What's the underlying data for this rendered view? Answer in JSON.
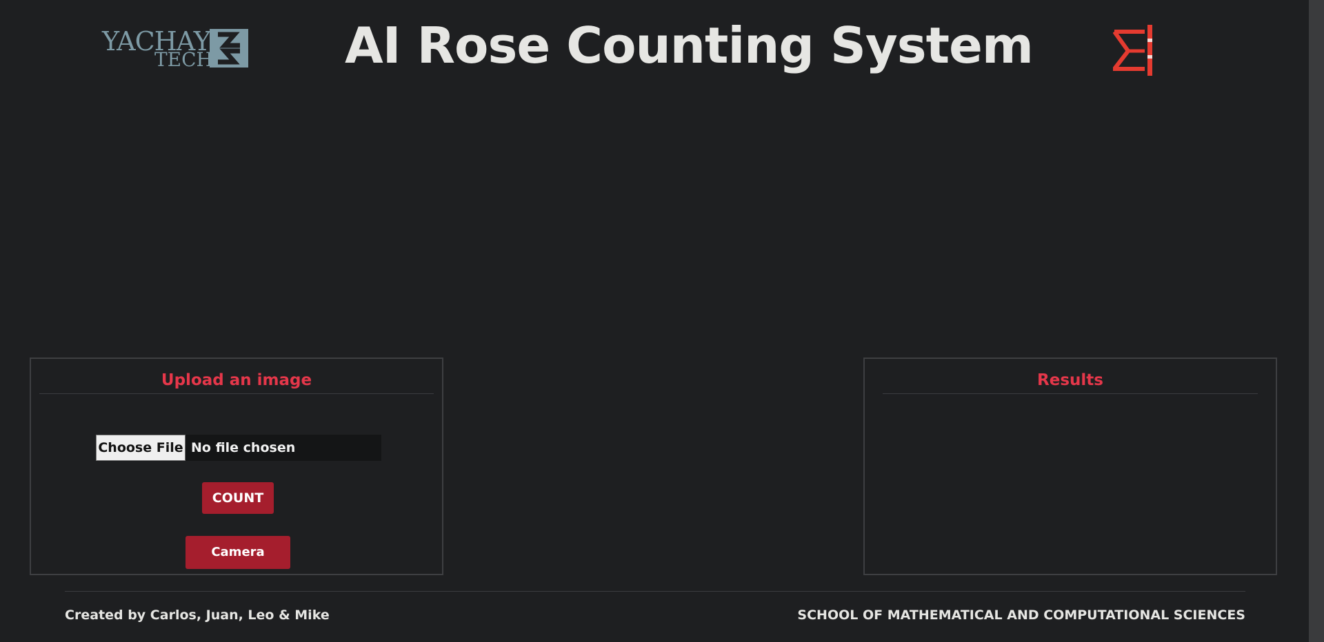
{
  "header": {
    "title": "AI Rose Counting System",
    "university_logo": {
      "line1": "YACHAY",
      "line2": "TECH",
      "icon": "yachay-tech-logo-icon"
    },
    "school_logo": {
      "icon": "sigma-school-logo-icon"
    }
  },
  "upload_panel": {
    "title": "Upload an image",
    "file_input": {
      "button_label": "Choose File",
      "status": "No file chosen"
    },
    "count_button": "COUNT",
    "camera_button": "Camera"
  },
  "results_panel": {
    "title": "Results"
  },
  "footer": {
    "credits": "Created by Carlos, Juan, Leo & Mike",
    "school": "SCHOOL OF MATHEMATICAL AND COMPUTATIONAL SCIENCES"
  },
  "colors": {
    "background": "#1e1f21",
    "title_text": "#e6e6e3",
    "accent_red": "#e5374a",
    "button_red": "#a51e2d",
    "yachay_blue": "#7d9aa5",
    "sigma_red": "#e53b30"
  }
}
